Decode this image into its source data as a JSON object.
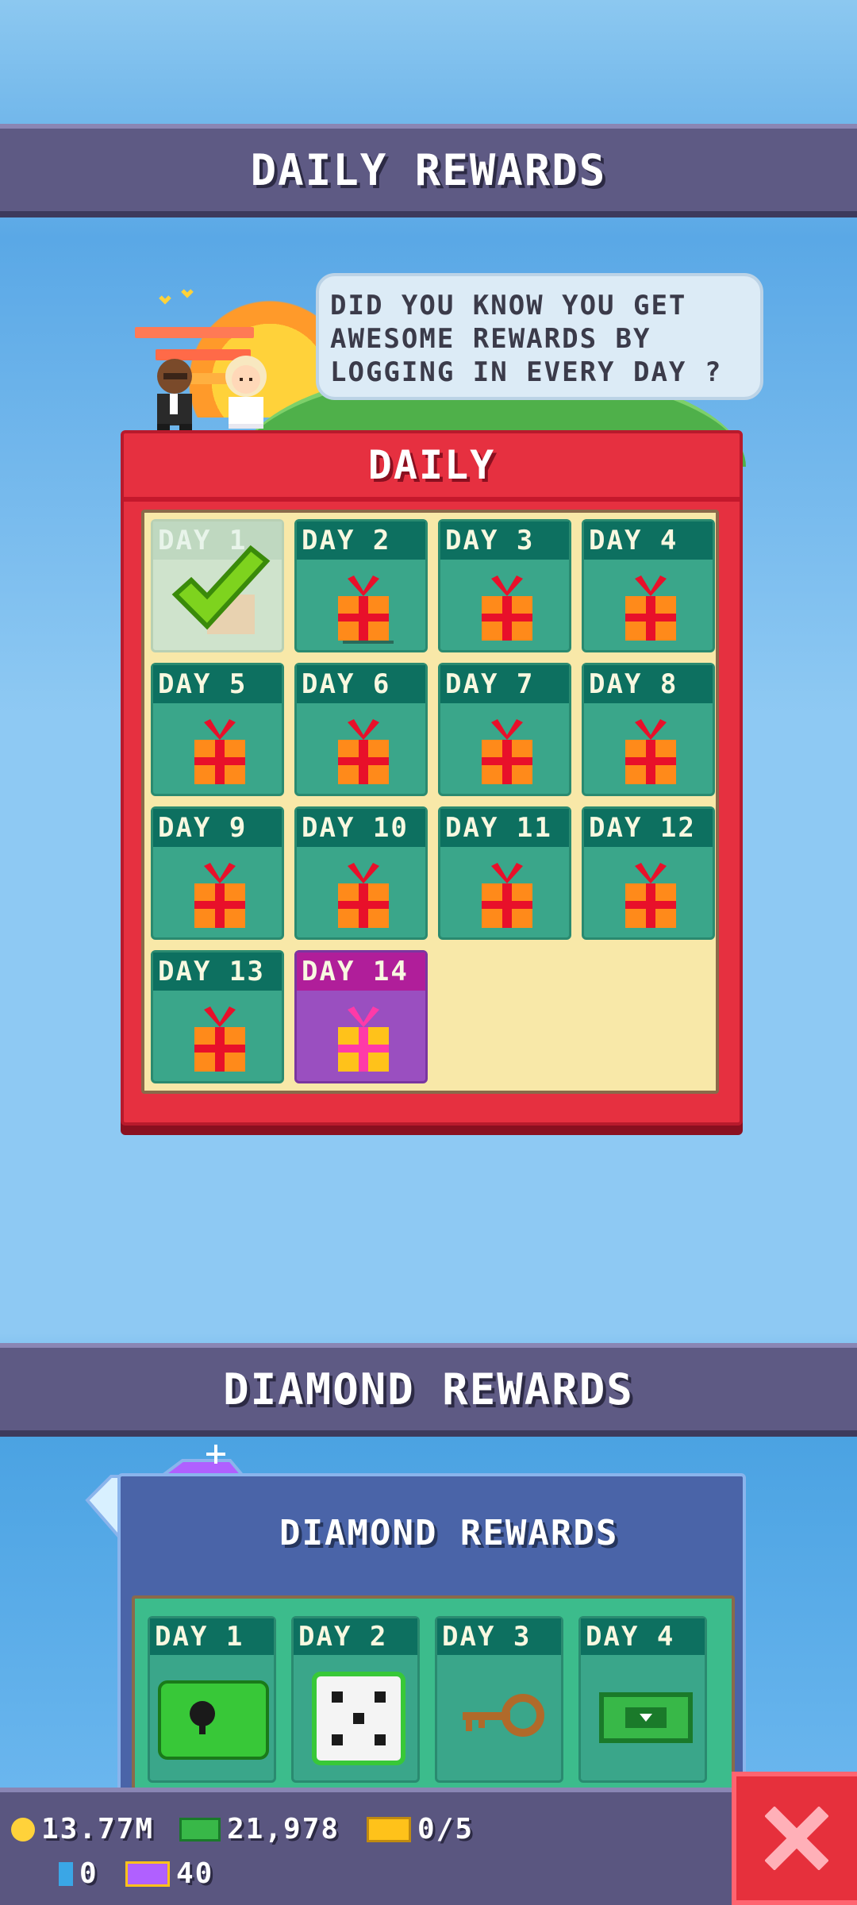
{
  "daily_banner": {
    "title": "DAILY REWARDS"
  },
  "speech": {
    "lines": [
      "DID YOU KNOW YOU GET",
      "AWESOME REWARDS BY",
      "LOGGING IN EVERY DAY ?"
    ]
  },
  "daily_panel": {
    "title": "DAILY",
    "days": [
      {
        "label": "DAY 1",
        "state": "claimed"
      },
      {
        "label": "DAY 2",
        "state": "locked"
      },
      {
        "label": "DAY 3",
        "state": "locked"
      },
      {
        "label": "DAY 4",
        "state": "locked"
      },
      {
        "label": "DAY 5",
        "state": "locked"
      },
      {
        "label": "DAY 6",
        "state": "locked"
      },
      {
        "label": "DAY 7",
        "state": "locked"
      },
      {
        "label": "DAY 8",
        "state": "locked"
      },
      {
        "label": "DAY 9",
        "state": "locked"
      },
      {
        "label": "DAY 10",
        "state": "locked"
      },
      {
        "label": "DAY 11",
        "state": "locked"
      },
      {
        "label": "DAY 12",
        "state": "locked"
      },
      {
        "label": "DAY 13",
        "state": "locked"
      },
      {
        "label": "DAY 14",
        "state": "special"
      }
    ]
  },
  "diamond_banner": {
    "title": "DIAMOND REWARDS"
  },
  "diamond_panel": {
    "title": "DIAMOND REWARDS",
    "days": [
      {
        "label": "DAY 1",
        "reward_icon": "green-chest-icon"
      },
      {
        "label": "DAY 2",
        "reward_icon": "dice-icon"
      },
      {
        "label": "DAY 3",
        "reward_icon": "key-icon"
      },
      {
        "label": "DAY 4",
        "reward_icon": "cash-icon"
      }
    ]
  },
  "currencies": {
    "coins": "13.77M",
    "cash": "21,978",
    "tickets": "0/5",
    "gems": "0",
    "vip_tokens": "40"
  },
  "colors": {
    "banner": "#5e5a84",
    "daily_panel": "#e63040",
    "tile": "#3aa68a",
    "tile_label": "#0d7060",
    "special_tile": "#9a4fc0",
    "close_button": "#e6303c"
  }
}
